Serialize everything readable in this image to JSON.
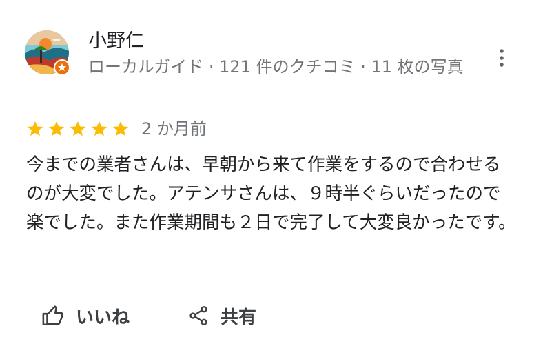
{
  "reviewer": {
    "name": "小野仁",
    "meta": "ローカルガイド · 121 件のクチコミ · 11 枚の写真",
    "avatar_icon": "avatar-illustration",
    "badge_icon": "local-guide-star-badge",
    "badge_color": "#e8710a"
  },
  "menu": {
    "icon": "more-vertical-icon"
  },
  "review": {
    "rating": 5,
    "rating_max": 5,
    "star_color": "#fbbc04",
    "date": "2 か月前",
    "text": "今までの業者さんは、早朝から来て作業をするので合わせるのが大変でした。アテンサさんは、９時半ぐらいだったので楽でした。また作業期間も２日で完了して大変良かったです。"
  },
  "actions": {
    "like_label": "いいね",
    "like_icon": "thumb-up-icon",
    "share_label": "共有",
    "share_icon": "share-icon"
  }
}
